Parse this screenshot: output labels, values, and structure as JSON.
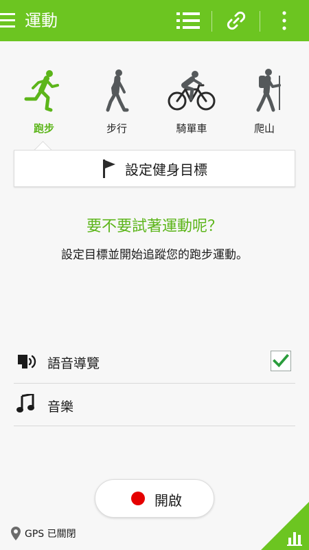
{
  "appbar": {
    "title": "運動",
    "accent": "#6cc521",
    "icons": [
      "menu-icon",
      "list-icon",
      "link-icon",
      "more-vert-icon"
    ]
  },
  "activities": [
    {
      "label": "跑步",
      "icon": "running-icon",
      "selected": true
    },
    {
      "label": "步行",
      "icon": "walking-icon",
      "selected": false
    },
    {
      "label": "騎單車",
      "icon": "cycling-icon",
      "selected": false
    },
    {
      "label": "爬山",
      "icon": "hiking-icon",
      "selected": false
    }
  ],
  "goal": {
    "label": "設定健身目標",
    "icon": "flag-icon"
  },
  "prompt": {
    "title": "要不要試著運動呢？",
    "subtitle": "設定目標並開始追蹤您的跑步運動。"
  },
  "settings": [
    {
      "label": "語音導覽",
      "icon": "voice-guide-icon",
      "checked": true
    },
    {
      "label": "音樂",
      "icon": "music-note-icon"
    }
  ],
  "start": {
    "label": "開啟"
  },
  "status": {
    "gps": "GPS 已關閉"
  },
  "colors": {
    "accent_green": "#5cb51a",
    "record_red": "#e50000"
  }
}
